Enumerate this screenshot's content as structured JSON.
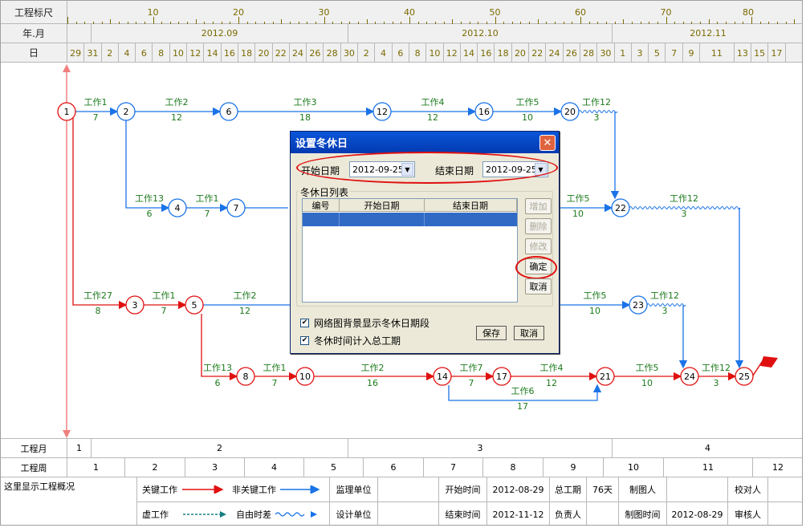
{
  "header": {
    "row1_label": "工程标尺",
    "row2_label": "年.月",
    "row3_label": "日",
    "ruler_numbers": [
      "10",
      "20",
      "30",
      "40",
      "50",
      "60",
      "70",
      "80"
    ],
    "months": [
      "2012.09",
      "2012.10",
      "2012.11"
    ],
    "days": [
      "29",
      "31",
      "2",
      "4",
      "6",
      "8",
      "10",
      "12",
      "14",
      "16",
      "18",
      "20",
      "22",
      "24",
      "26",
      "28",
      "30",
      "2",
      "4",
      "6",
      "8",
      "10",
      "12",
      "14",
      "16",
      "18",
      "20",
      "22",
      "24",
      "26",
      "28",
      "30",
      "1",
      "3",
      "5",
      "7",
      "9",
      "11",
      "13",
      "15",
      "17"
    ]
  },
  "network": {
    "nodes": [
      "1",
      "2",
      "6",
      "12",
      "16",
      "20",
      "22",
      "4",
      "7",
      "3",
      "5",
      "23",
      "8",
      "10",
      "14",
      "17",
      "21",
      "24",
      "25"
    ],
    "activities": [
      {
        "name": "工作1",
        "dur": "7"
      },
      {
        "name": "工作2",
        "dur": "12"
      },
      {
        "name": "工作3",
        "dur": "18"
      },
      {
        "name": "工作4",
        "dur": "12"
      },
      {
        "name": "工作5",
        "dur": "10"
      },
      {
        "name": "工作12",
        "dur": "3"
      },
      {
        "name": "工作13",
        "dur": "6"
      },
      {
        "name": "工作1",
        "dur": "7"
      },
      {
        "name": "工作5",
        "dur": "10"
      },
      {
        "name": "工作12",
        "dur": "3"
      },
      {
        "name": "工作27",
        "dur": "8"
      },
      {
        "name": "工作1",
        "dur": "7"
      },
      {
        "name": "工作2",
        "dur": "12"
      },
      {
        "name": "工作5",
        "dur": "10"
      },
      {
        "name": "工作12",
        "dur": "3"
      },
      {
        "name": "工作13",
        "dur": "6"
      },
      {
        "name": "工作1",
        "dur": "7"
      },
      {
        "name": "工作2",
        "dur": "16"
      },
      {
        "name": "工作7",
        "dur": "7"
      },
      {
        "name": "工作4",
        "dur": "12"
      },
      {
        "name": "工作5",
        "dur": "10"
      },
      {
        "name": "工作12",
        "dur": "3"
      },
      {
        "name": "工作6",
        "dur": "17"
      }
    ],
    "colors": {
      "critical": "#e01010",
      "noncritical": "#1a73e8",
      "label": "#1d7a1d",
      "wave": "#1a73e8"
    }
  },
  "dialog": {
    "title": "设置冬休日",
    "start_label": "开始日期",
    "start_value": "2012-09-25",
    "end_label": "结束日期",
    "end_value": "2012-09-25",
    "list_group": "冬休日列表",
    "columns": [
      "编号",
      "开始日期",
      "结束日期"
    ],
    "buttons": {
      "add": "增加",
      "delete": "删除",
      "modify": "修改",
      "ok": "确定",
      "cancel": "取消"
    },
    "checkbox1": "网络图背景显示冬休日期段",
    "checkbox2": "冬休时间计入总工期",
    "save": "保存",
    "cancel2": "取消"
  },
  "footer": {
    "month_label": "工程月",
    "week_label": "工程周",
    "months": [
      "1",
      "2",
      "3",
      "4"
    ],
    "weeks": [
      "1",
      "2",
      "3",
      "4",
      "5",
      "6",
      "7",
      "8",
      "9",
      "10",
      "11",
      "12"
    ],
    "overview": "这里显示工程概况",
    "legend": {
      "critical": "关键工作",
      "noncritical": "非关键工作",
      "virtual": "虚工作",
      "free_float": "自由时差"
    },
    "supervisor": "监理单位",
    "designer": "设计单位",
    "start_time_label": "开始时间",
    "start_time": "2012-08-29",
    "end_time_label": "结束时间",
    "end_time": "2012-11-12",
    "total_label": "总工期",
    "total": "76天",
    "owner_label": "负责人",
    "drawer_label": "制图人",
    "draw_time_label": "制图时间",
    "draw_time": "2012-08-29",
    "checker_label": "校对人",
    "reviewer_label": "审核人"
  }
}
